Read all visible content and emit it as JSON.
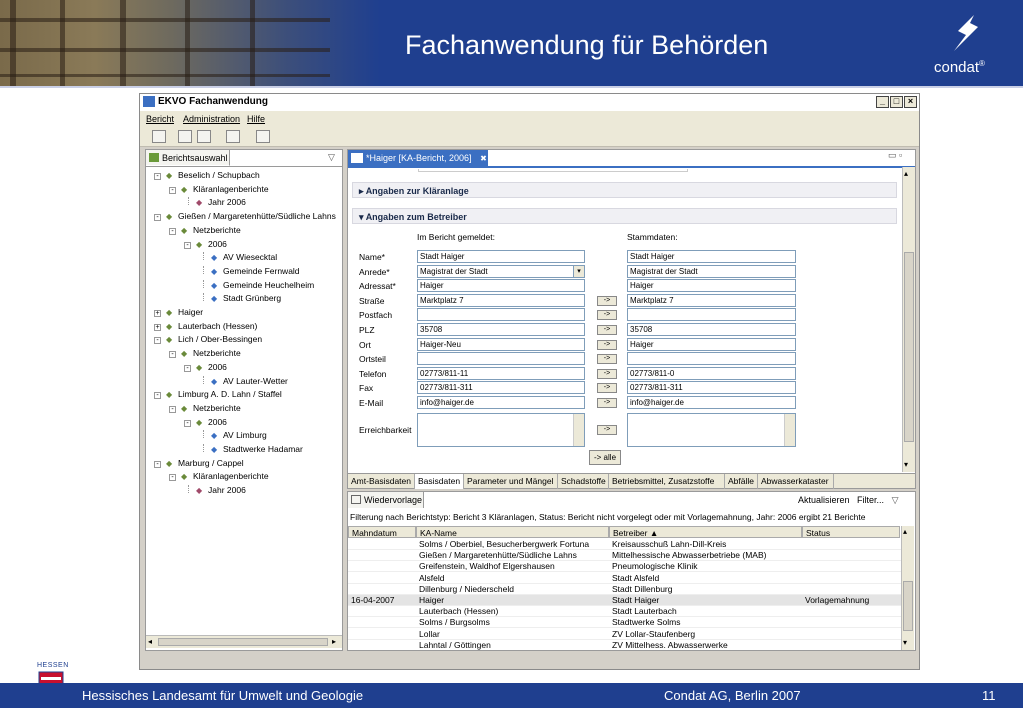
{
  "slide": {
    "title": "Fachanwendung für Behörden",
    "brand": "condat",
    "brand_mark": "®",
    "footer_left": "Hessisches Landesamt für Umwelt und Geologie",
    "footer_center": "Condat AG, Berlin 2007",
    "footer_page": "11",
    "hessen_label": "HESSEN"
  },
  "window": {
    "title": "EKVO Fachanwendung",
    "menu": [
      "Bericht",
      "Administration",
      "Hilfe"
    ]
  },
  "left_panel": {
    "tab_label": "Berichtsauswahl",
    "tree": [
      {
        "label": "Beselich / Schupbach",
        "level": 0,
        "exp": "-"
      },
      {
        "label": "Kläranlagenberichte",
        "level": 1,
        "exp": "-"
      },
      {
        "label": "Jahr 2006",
        "level": 2,
        "exp": ""
      },
      {
        "label": "Gießen / Margaretenhütte/Südliche Lahns",
        "level": 0,
        "exp": "-"
      },
      {
        "label": "Netzberichte",
        "level": 1,
        "exp": "-"
      },
      {
        "label": "2006",
        "level": 2,
        "exp": "-"
      },
      {
        "label": "AV Wiesecktal",
        "level": 3,
        "exp": ""
      },
      {
        "label": "Gemeinde Fernwald",
        "level": 3,
        "exp": ""
      },
      {
        "label": "Gemeinde Heuchelheim",
        "level": 3,
        "exp": ""
      },
      {
        "label": "Stadt Grünberg",
        "level": 3,
        "exp": ""
      },
      {
        "label": "Haiger",
        "level": 0,
        "exp": "+"
      },
      {
        "label": "Lauterbach (Hessen)",
        "level": 0,
        "exp": "+"
      },
      {
        "label": "Lich / Ober-Bessingen",
        "level": 0,
        "exp": "-"
      },
      {
        "label": "Netzberichte",
        "level": 1,
        "exp": "-"
      },
      {
        "label": "2006",
        "level": 2,
        "exp": "-"
      },
      {
        "label": "AV Lauter-Wetter",
        "level": 3,
        "exp": ""
      },
      {
        "label": "Limburg A. D. Lahn / Staffel",
        "level": 0,
        "exp": "-"
      },
      {
        "label": "Netzberichte",
        "level": 1,
        "exp": "-"
      },
      {
        "label": "2006",
        "level": 2,
        "exp": "-"
      },
      {
        "label": "AV Limburg",
        "level": 3,
        "exp": ""
      },
      {
        "label": "Stadtwerke Hadamar",
        "level": 3,
        "exp": ""
      },
      {
        "label": "Marburg / Cappel",
        "level": 0,
        "exp": "-"
      },
      {
        "label": "Kläranlagenberichte",
        "level": 1,
        "exp": "-"
      },
      {
        "label": "Jahr 2006",
        "level": 2,
        "exp": ""
      }
    ]
  },
  "editor": {
    "tab_label": "*Haiger [KA-Bericht, 2006]",
    "close_glyph": "✖",
    "section1": "Angaben zur Kläranlage",
    "section2": "Angaben zum Betreiber",
    "col_reported": "Im Bericht gemeldet:",
    "col_master": "Stammdaten:",
    "arrow_label": "->",
    "all_button": "-> alle",
    "fields": [
      {
        "label": "Name*",
        "reported": "Stadt Haiger",
        "master": "Stadt Haiger",
        "arrow": false
      },
      {
        "label": "Anrede*",
        "reported": "Magistrat der Stadt",
        "master": "Magistrat der Stadt",
        "arrow": false,
        "select": true
      },
      {
        "label": "Adressat*",
        "reported": "Haiger",
        "master": "Haiger",
        "arrow": false
      },
      {
        "label": "Straße",
        "reported": "Marktplatz 7",
        "master": "Marktplatz 7",
        "arrow": true
      },
      {
        "label": "Postfach",
        "reported": "",
        "master": "",
        "arrow": true
      },
      {
        "label": "PLZ",
        "reported": "35708",
        "master": "35708",
        "arrow": true
      },
      {
        "label": "Ort",
        "reported": "Haiger-Neu",
        "master": "Haiger",
        "arrow": true
      },
      {
        "label": "Ortsteil",
        "reported": "",
        "master": "",
        "arrow": true
      },
      {
        "label": "Telefon",
        "reported": "02773/811-11",
        "master": "02773/811-0",
        "arrow": true
      },
      {
        "label": "Fax",
        "reported": "02773/811-311",
        "master": "02773/811-311",
        "arrow": true
      },
      {
        "label": "E-Mail",
        "reported": "info@haiger.de",
        "master": "info@haiger.de",
        "arrow": true
      }
    ],
    "reachability_label": "Erreichbarkeit",
    "bottom_tabs": [
      "Amt-Basisdaten",
      "Basisdaten",
      "Parameter und Mängel",
      "Schadstoffe",
      "Betriebsmittel, Zusatzstoffe",
      "Abfälle",
      "Abwasserkataster"
    ],
    "active_bottom_tab": "Basisdaten"
  },
  "resubmission": {
    "tab_label": "Wiedervorlage",
    "refresh_label": "Aktualisieren",
    "filter_label": "Filter...",
    "filter_text": "Filterung nach Berichtstyp: Bericht 3 Kläranlagen, Status: Bericht nicht vorgelegt oder mit Vorlagemahnung, Jahr:  2006    ergibt  21 Berichte",
    "columns": [
      "Mahndatum",
      "KA-Name",
      "Betreiber  ▲",
      "Status"
    ],
    "rows": [
      {
        "date": "",
        "name": "Solms / Oberbiel, Besucherbergwerk Fortuna",
        "operator": "Kreisausschuß Lahn-Dill-Kreis",
        "status": ""
      },
      {
        "date": "",
        "name": "Gießen / Margaretenhütte/Südliche Lahns",
        "operator": "Mittelhessische Abwasserbetriebe (MAB)",
        "status": ""
      },
      {
        "date": "",
        "name": "Greifenstein, Waldhof Elgershausen",
        "operator": "Pneumologische Klinik",
        "status": ""
      },
      {
        "date": "",
        "name": "Alsfeld",
        "operator": "Stadt Alsfeld",
        "status": ""
      },
      {
        "date": "",
        "name": "Dillenburg / Niederscheld",
        "operator": "Stadt Dillenburg",
        "status": ""
      },
      {
        "date": "16-04-2007",
        "name": "Haiger",
        "operator": "Stadt Haiger",
        "status": "Vorlagemahnung",
        "selected": true
      },
      {
        "date": "",
        "name": "Lauterbach (Hessen)",
        "operator": "Stadt Lauterbach",
        "status": ""
      },
      {
        "date": "",
        "name": "Solms / Burgsolms",
        "operator": "Stadtwerke Solms",
        "status": ""
      },
      {
        "date": "",
        "name": "Lollar",
        "operator": "ZV Lollar-Staufenberg",
        "status": ""
      },
      {
        "date": "",
        "name": "Lahntal / Göttingen",
        "operator": "ZV Mittelhess. Abwasserwerke",
        "status": ""
      }
    ]
  },
  "colors": {
    "accent": "#1f3f8f",
    "tab_active": "#3b6fc2"
  }
}
